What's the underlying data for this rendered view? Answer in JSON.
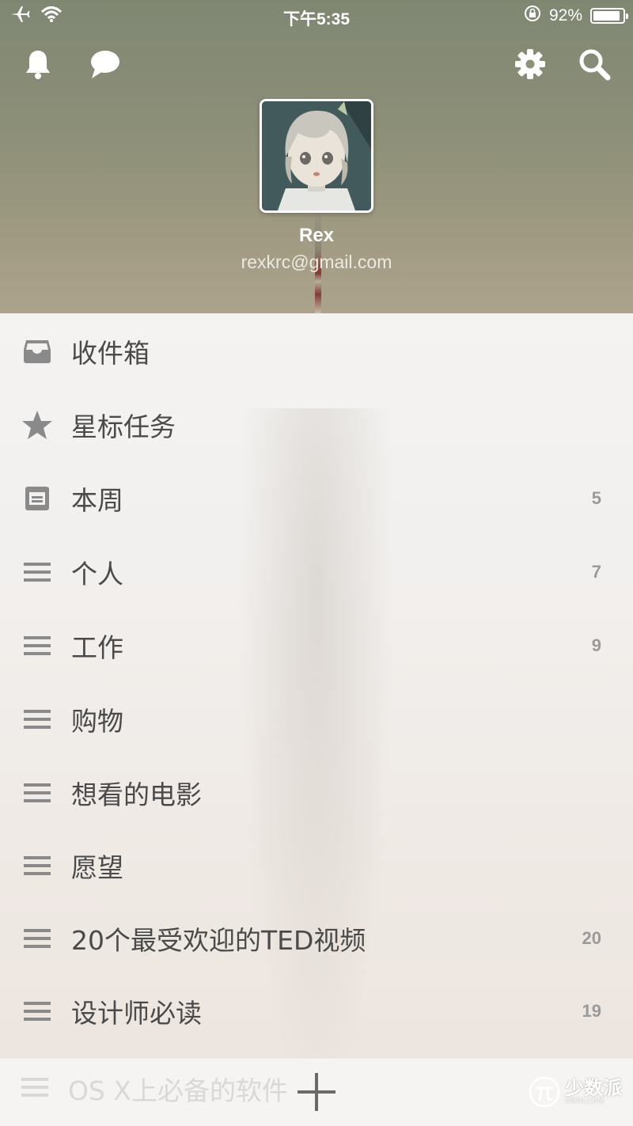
{
  "status_bar": {
    "time": "下午5:35",
    "battery": "92%",
    "battery_level": 0.92
  },
  "header": {
    "user_name": "Rex",
    "user_email": "rexkrc@gmail.com",
    "icons": [
      "bell-icon",
      "chat-bubble-icon",
      "gear-icon",
      "search-icon"
    ]
  },
  "lists": [
    {
      "icon": "inbox-icon",
      "label": "收件箱",
      "count": ""
    },
    {
      "icon": "star-icon",
      "label": "星标任务",
      "count": ""
    },
    {
      "icon": "week-calendar-icon",
      "label": "本周",
      "count": "5"
    },
    {
      "icon": "list-icon",
      "label": "个人",
      "count": "7"
    },
    {
      "icon": "list-icon",
      "label": "工作",
      "count": "9"
    },
    {
      "icon": "list-icon",
      "label": "购物",
      "count": ""
    },
    {
      "icon": "list-icon",
      "label": "想看的电影",
      "count": ""
    },
    {
      "icon": "list-icon",
      "label": "愿望",
      "count": ""
    },
    {
      "icon": "list-icon",
      "label": "20个最受欢迎的TED视频",
      "count": "20"
    },
    {
      "icon": "list-icon",
      "label": "设计师必读",
      "count": "19"
    }
  ],
  "footer": {
    "partial_list_label": "OS X上必备的软件",
    "add_icon": "plus-icon",
    "watermark_text": "少数派",
    "watermark_sub": "SSPAI.COM"
  },
  "colors": {
    "header_bg": "#8e9079",
    "icon_gray": "#8a8a8a",
    "label_text": "#4a4a4a",
    "count_text": "#9a9a9a"
  }
}
